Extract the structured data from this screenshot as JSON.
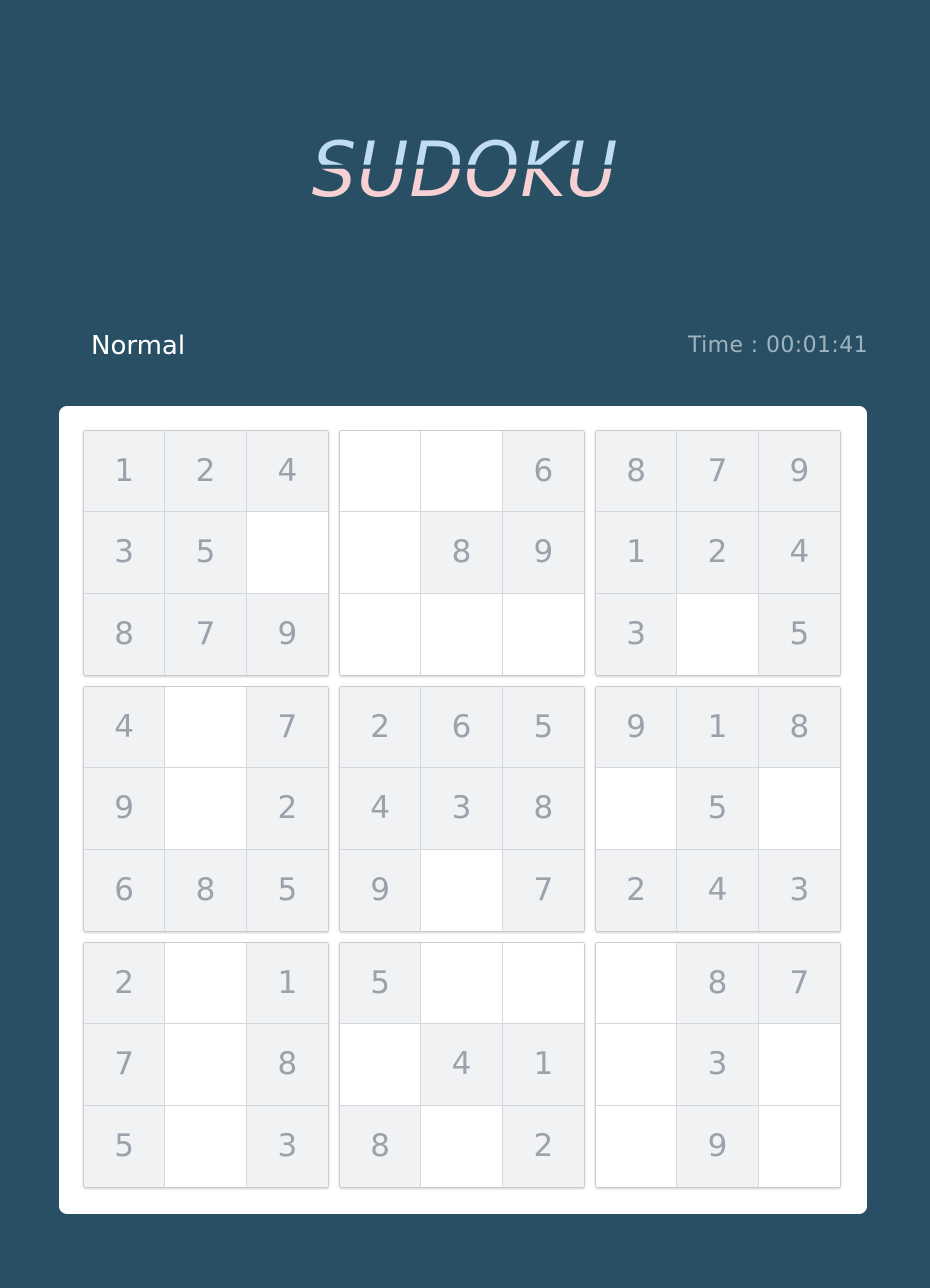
{
  "header": {
    "title": "SUDOKU"
  },
  "status": {
    "difficulty": "Normal",
    "timer": "Time : 00:01:41"
  },
  "colors": {
    "background": "#284f63",
    "logo_top": "#bfdcf3",
    "logo_bottom": "#f7d0d4",
    "given_cell": "#f1f2f4",
    "empty_cell": "#ffffff",
    "digit": "#9ca1ab"
  },
  "board": {
    "blocks": [
      [
        "1",
        "2",
        "4",
        "3",
        "5",
        "",
        "8",
        "7",
        "9"
      ],
      [
        "",
        "",
        "6",
        "",
        "8",
        "9",
        "",
        "",
        ""
      ],
      [
        "8",
        "7",
        "9",
        "1",
        "2",
        "4",
        "3",
        "",
        "5"
      ],
      [
        "4",
        "",
        "7",
        "9",
        "",
        "2",
        "6",
        "8",
        "5"
      ],
      [
        "2",
        "6",
        "5",
        "4",
        "3",
        "8",
        "9",
        "",
        "7"
      ],
      [
        "9",
        "1",
        "8",
        "",
        "5",
        "",
        "2",
        "4",
        "3"
      ],
      [
        "2",
        "",
        "1",
        "7",
        "",
        "8",
        "5",
        "",
        "3"
      ],
      [
        "5",
        "",
        "",
        "",
        "4",
        "1",
        "8",
        "",
        "2"
      ],
      [
        "",
        "8",
        "7",
        "",
        "3",
        "",
        "",
        "9",
        ""
      ]
    ]
  }
}
